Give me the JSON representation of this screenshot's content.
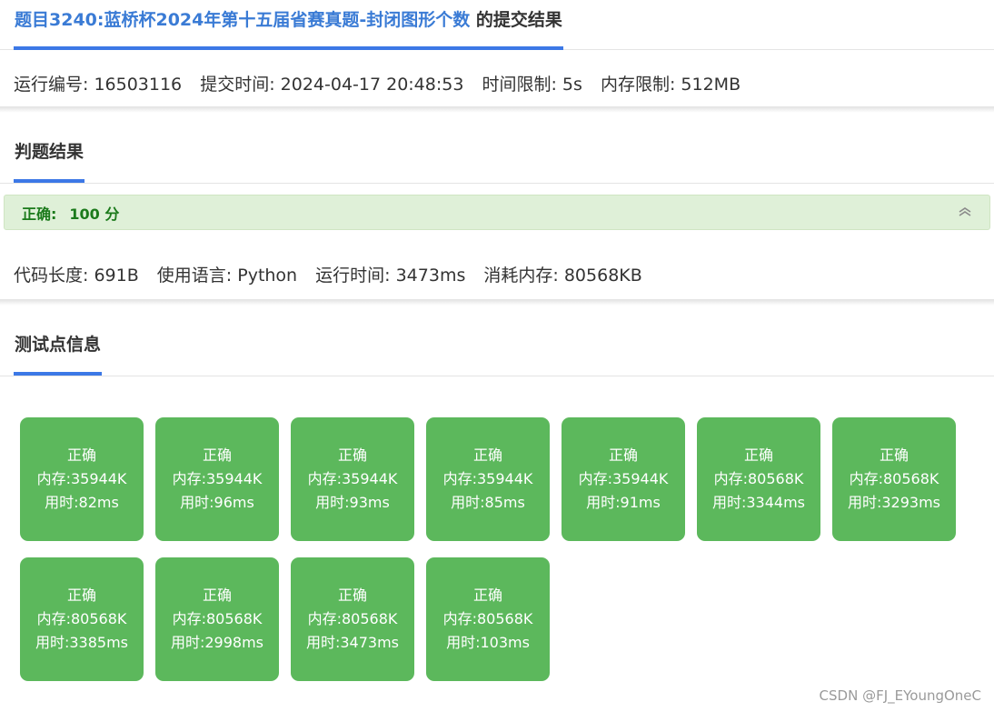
{
  "header": {
    "title_link": "题目3240:蓝桥杯2024年第十五届省赛真题-封闭图形个数",
    "title_suffix": " 的提交结果"
  },
  "submission_info": {
    "run_id": "运行编号: 16503116",
    "submit_time": "提交时间: 2024-04-17 20:48:53",
    "time_limit": "时间限制: 5s",
    "memory_limit": "内存限制: 512MB"
  },
  "judge": {
    "section_title": "判题结果",
    "status": "正确:",
    "score": "100 分",
    "collapse_icon": "double-chevron-up-icon",
    "code_length": "代码长度: 691B",
    "language": "使用语言: Python",
    "run_time": "运行时间: 3473ms",
    "memory_used": "消耗内存: 80568KB"
  },
  "tests": {
    "section_title": "测试点信息",
    "cases": [
      {
        "status": "正确",
        "memory": "内存:35944K",
        "time": "用时:82ms"
      },
      {
        "status": "正确",
        "memory": "内存:35944K",
        "time": "用时:96ms"
      },
      {
        "status": "正确",
        "memory": "内存:35944K",
        "time": "用时:93ms"
      },
      {
        "status": "正确",
        "memory": "内存:35944K",
        "time": "用时:85ms"
      },
      {
        "status": "正确",
        "memory": "内存:35944K",
        "time": "用时:91ms"
      },
      {
        "status": "正确",
        "memory": "内存:80568K",
        "time": "用时:3344ms"
      },
      {
        "status": "正确",
        "memory": "内存:80568K",
        "time": "用时:3293ms"
      },
      {
        "status": "正确",
        "memory": "内存:80568K",
        "time": "用时:3385ms"
      },
      {
        "status": "正确",
        "memory": "内存:80568K",
        "time": "用时:2998ms"
      },
      {
        "status": "正确",
        "memory": "内存:80568K",
        "time": "用时:3473ms"
      },
      {
        "status": "正确",
        "memory": "内存:80568K",
        "time": "用时:103ms"
      }
    ]
  },
  "colors": {
    "accent": "#3c78e6",
    "title_link": "#3a7bd5",
    "case_bg": "#5cb85c",
    "result_bg": "#dff0d8",
    "result_text": "#1b7a1b"
  },
  "watermark": "CSDN @FJ_EYoungOneC"
}
